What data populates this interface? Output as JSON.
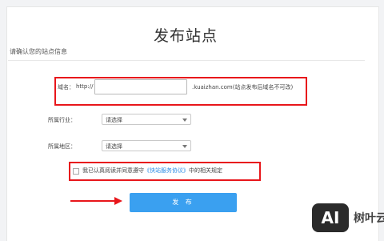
{
  "page": {
    "title": "发布站点",
    "subtitle": "请确认您的站点信息"
  },
  "domain": {
    "label": "域名：",
    "prefix": "http://",
    "value": "",
    "suffix": ".kuaizhan.com(站点发布后域名不可改)"
  },
  "industry": {
    "label": "所属行业：",
    "selected": "请选择"
  },
  "region": {
    "label": "所属地区：",
    "selected": "请选择"
  },
  "agreement": {
    "before": "我已认真阅读并同意遵守",
    "link": "《快站服务协议》",
    "after": "中的相关规定",
    "checked": false
  },
  "actions": {
    "submit_label": "发 布"
  },
  "watermark": {
    "badge": "AI",
    "text": "树叶云"
  },
  "colors": {
    "highlight": "#e8161b",
    "primary": "#3aa0f0",
    "link": "#2c8de6"
  }
}
